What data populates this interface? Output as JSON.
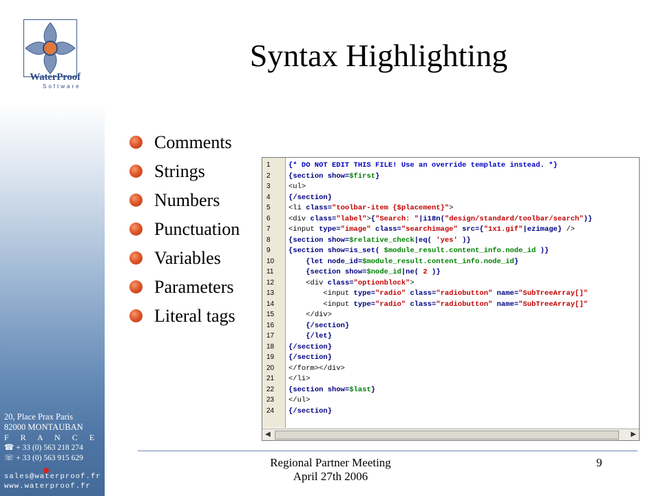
{
  "slide": {
    "title": "Syntax Highlighting",
    "bullets": [
      "Comments",
      "Strings",
      "Numbers",
      "Punctuation",
      "Variables",
      "Parameters",
      "Literal tags"
    ],
    "footer": [
      "Regional Partner Meeting",
      "April 27th 2006"
    ],
    "page_number": "9"
  },
  "logo": {
    "wordmark": "WaterProof",
    "subtitle": "Software"
  },
  "contact": {
    "address_line1": "20, Place Prax Paris",
    "address_line2": "82000 MONTAUBAN",
    "country": "F R A N C E",
    "phone": "+ 33 (0) 563 218 274",
    "fax": "+ 33 (0) 563 915 629",
    "email": "sales@waterproof.fr",
    "website": "www.waterproof.fr",
    "phone_icon": "phone-icon",
    "fax_icon": "fax-icon"
  },
  "code_editor": {
    "line_numbers": [
      "1",
      "2",
      "3",
      "4",
      "5",
      "6",
      "7",
      "8",
      "9",
      "10",
      "11",
      "12",
      "13",
      "14",
      "15",
      "16",
      "17",
      "18",
      "19",
      "20",
      "21",
      "22",
      "23",
      "24"
    ],
    "lines": [
      "{* DO NOT EDIT THIS FILE! Use an override template instead. *}",
      "{section show=$first}",
      "<ul>",
      "{/section}",
      "<li class=\"toolbar-item {$placement}\">",
      "<div class=\"label\">{\"Search: \"|i18n(\"design/standard/toolbar/search\")}",
      "<input type=\"image\" class=\"searchimage\" src={\"1x1.gif\"|ezimage} />",
      "{section show=$relative_check|eq( 'yes' )}",
      "{section show=is_set( $module_result.content_info.node_id )}",
      "    {let node_id=$module_result.content_info.node_id}",
      "    {section show=$node_id|ne( 2 )}",
      "    <div class=\"optionblock\">",
      "        <input type=\"radio\" class=\"radiobutton\" name=\"SubTreeArray[]\"",
      "        <input type=\"radio\" class=\"radiobutton\" name=\"SubTreeArray[]\"",
      "    </div>",
      "    {/section}",
      "    {/let}",
      "{/section}",
      "{/section}",
      "</form></div>",
      "</li>",
      "{section show=$last}",
      "</ul>",
      "{/section}"
    ]
  },
  "colors": {
    "bullet": "#e0582b",
    "comment": "#0000c0",
    "string": "#c00000",
    "keyword": "#000080",
    "variable": "#008000",
    "sidebar_dark": "#446a98",
    "footer_rule": "#6b87b5"
  }
}
